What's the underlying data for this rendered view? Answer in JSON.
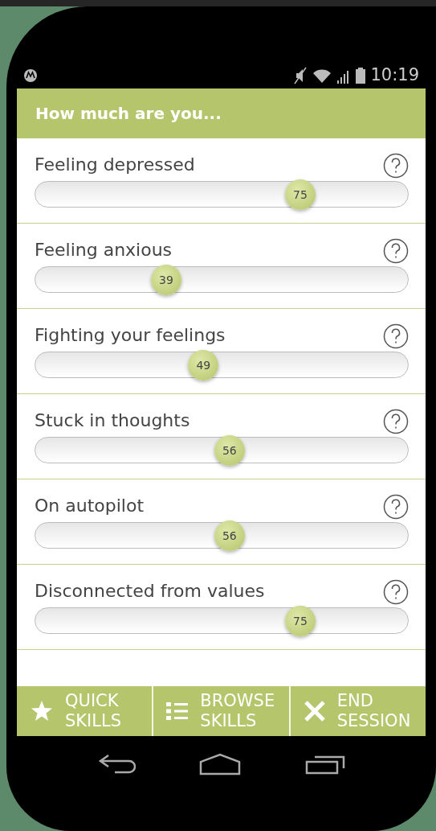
{
  "status_bar": {
    "time": "10:19"
  },
  "header": {
    "title": "How much are you..."
  },
  "sliders": [
    {
      "label": "Feeling depressed",
      "value": "75",
      "level": 0.75
    },
    {
      "label": "Feeling anxious",
      "value": "39",
      "level": 0.39
    },
    {
      "label": "Fighting your feelings",
      "value": "49",
      "level": 0.49
    },
    {
      "label": "Stuck in thoughts",
      "value": "56",
      "level": 0.56
    },
    {
      "label": "On autopilot",
      "value": "56",
      "level": 0.56
    },
    {
      "label": "Disconnected from values",
      "value": "75",
      "level": 0.75
    }
  ],
  "bottom_bar": [
    {
      "kind": "star",
      "label": "QUICK SKILLS"
    },
    {
      "kind": "list",
      "label": "BROWSE SKILLS"
    },
    {
      "kind": "close",
      "label": "END SESSION"
    }
  ]
}
